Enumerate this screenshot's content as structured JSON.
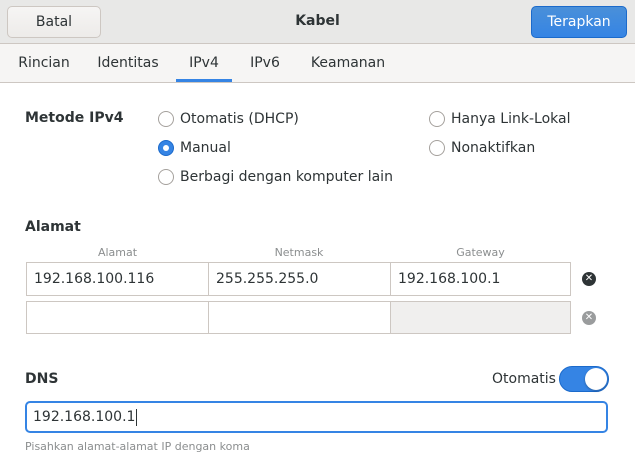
{
  "header": {
    "cancel_label": "Batal",
    "title": "Kabel",
    "apply_label": "Terapkan"
  },
  "tabs": [
    {
      "label": "Rincian",
      "active": false
    },
    {
      "label": "Identitas",
      "active": false
    },
    {
      "label": "IPv4",
      "active": true
    },
    {
      "label": "IPv6",
      "active": false
    },
    {
      "label": "Keamanan",
      "active": false
    }
  ],
  "method": {
    "label": "Metode IPv4",
    "options": [
      {
        "label": "Otomatis (DHCP)",
        "checked": false
      },
      {
        "label": "Manual",
        "checked": true
      },
      {
        "label": "Berbagi dengan komputer lain",
        "checked": false
      },
      {
        "label": "Hanya Link-Lokal",
        "checked": false
      },
      {
        "label": "Nonaktifkan",
        "checked": false
      }
    ]
  },
  "addresses": {
    "label": "Alamat",
    "columns": [
      "Alamat",
      "Netmask",
      "Gateway"
    ],
    "rows": [
      {
        "address": "192.168.100.116",
        "netmask": "255.255.255.0",
        "gateway": "192.168.100.1"
      },
      {
        "address": "",
        "netmask": "",
        "gateway": ""
      }
    ]
  },
  "dns": {
    "label": "DNS",
    "auto_label": "Otomatis",
    "auto_enabled": true,
    "value": "192.168.100.1",
    "hint": "Pisahkan alamat-alamat IP dengan koma"
  },
  "colors": {
    "accent": "#3584e4",
    "header_bg": "#e8e8e7",
    "text": "#2e3436",
    "dim_text": "#8b8e8f"
  }
}
